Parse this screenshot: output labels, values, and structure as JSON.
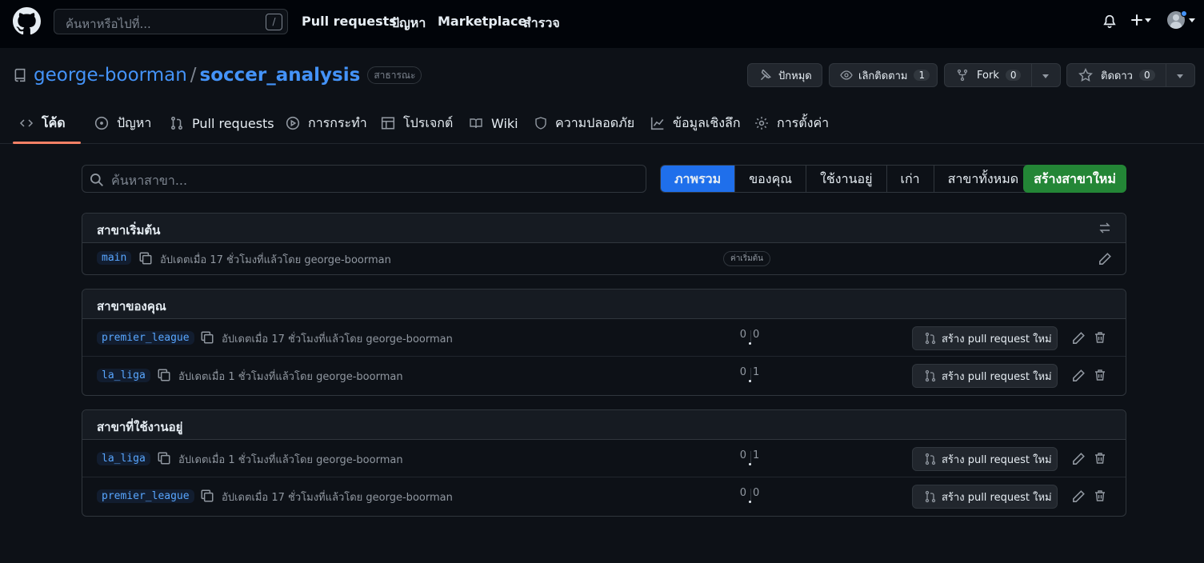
{
  "header": {
    "search_placeholder": "ค้นหาหรือไปที่...",
    "search_shortcut": "/",
    "nav": [
      "Pull requests",
      "ปัญหา",
      "Marketplace",
      "สำรวจ"
    ]
  },
  "repo": {
    "owner": "george-boorman",
    "separator": "/",
    "name": "soccer_analysis",
    "visibility": "สาธารณะ",
    "pin_label": "ปักหมุด",
    "watch_label": "เลิกติดตาม",
    "watch_count": "1",
    "fork_label": "Fork",
    "fork_count": "0",
    "star_label": "ติดดาว",
    "star_count": "0"
  },
  "tabs": [
    {
      "label": "โค้ด",
      "icon": "code-icon"
    },
    {
      "label": "ปัญหา",
      "icon": "issue-icon"
    },
    {
      "label": "Pull requests",
      "icon": "pull-request-icon"
    },
    {
      "label": "การกระทำ",
      "icon": "play-icon"
    },
    {
      "label": "โปรเจกต์",
      "icon": "table-icon"
    },
    {
      "label": "Wiki",
      "icon": "book-icon"
    },
    {
      "label": "ความปลอดภัย",
      "icon": "shield-icon"
    },
    {
      "label": "ข้อมูลเชิงลึก",
      "icon": "graph-icon"
    },
    {
      "label": "การตั้งค่า",
      "icon": "gear-icon"
    }
  ],
  "filter": {
    "search_placeholder": "ค้นหาสาขา...",
    "options": [
      "ภาพรวม",
      "ของคุณ",
      "ใช้งานอยู่",
      "เก่า",
      "สาขาทั้งหมด"
    ],
    "new_branch_label": "สร้างสาขาใหม่"
  },
  "sections": {
    "default": {
      "title": "สาขาเริ่มต้น",
      "rows": [
        {
          "name": "main",
          "updated": "อัปเดตเมื่อ 17 ชั่วโมงที่แล้วโดย george-boorman",
          "badge": "ค่าเริ่มต้น"
        }
      ]
    },
    "yours": {
      "title": "สาขาของคุณ",
      "rows": [
        {
          "name": "premier_league",
          "updated": "อัปเดตเมื่อ 17 ชั่วโมงที่แล้วโดย george-boorman",
          "behind": "0",
          "ahead": "0",
          "pr_label": "สร้าง pull request ใหม่"
        },
        {
          "name": "la_liga",
          "updated": "อัปเดตเมื่อ 1 ชั่วโมงที่แล้วโดย george-boorman",
          "behind": "0",
          "ahead": "1",
          "pr_label": "สร้าง pull request ใหม่"
        }
      ]
    },
    "active": {
      "title": "สาขาที่ใช้งานอยู่",
      "rows": [
        {
          "name": "la_liga",
          "updated": "อัปเดตเมื่อ 1 ชั่วโมงที่แล้วโดย george-boorman",
          "behind": "0",
          "ahead": "1",
          "pr_label": "สร้าง pull request ใหม่"
        },
        {
          "name": "premier_league",
          "updated": "อัปเดตเมื่อ 17 ชั่วโมงที่แล้วโดย george-boorman",
          "behind": "0",
          "ahead": "0",
          "pr_label": "สร้าง pull request ใหม่"
        }
      ]
    }
  },
  "colors": {
    "accent": "#1f6feb",
    "primary_button": "#238636",
    "link": "#4493f8",
    "tab_underline": "#f78166"
  }
}
